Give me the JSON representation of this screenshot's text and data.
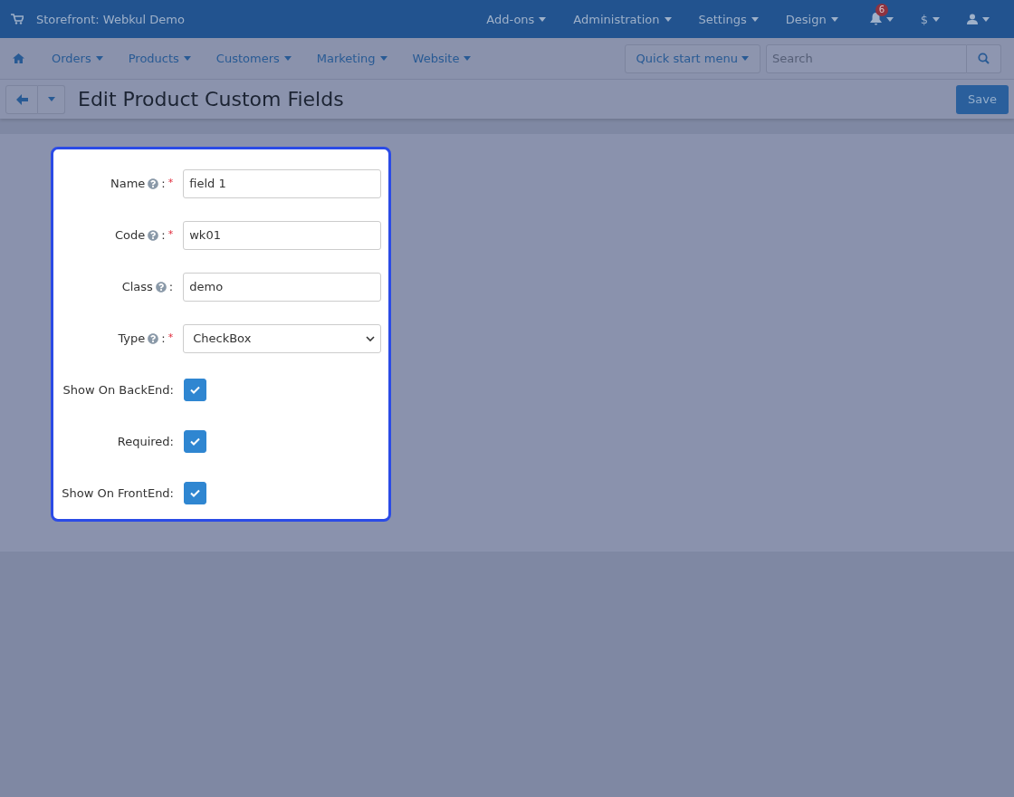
{
  "top_bar": {
    "store": "Storefront: Webkul Demo",
    "menus": [
      "Add-ons",
      "Administration",
      "Settings",
      "Design"
    ],
    "notifications": "6",
    "currency": "$"
  },
  "nav": {
    "items": [
      "Orders",
      "Products",
      "Customers",
      "Marketing",
      "Website"
    ],
    "quick_start": "Quick start menu",
    "search": {
      "placeholder": "Search"
    }
  },
  "title": "Edit Product Custom Fields",
  "save": "Save",
  "fields": [
    {
      "kind": "text",
      "label": "Name",
      "help": true,
      "colon": ":",
      "required_mark": "*",
      "value": "field 1"
    },
    {
      "kind": "text",
      "label": "Code",
      "help": true,
      "colon": ":",
      "required_mark": "*",
      "value": "wk01"
    },
    {
      "kind": "text",
      "label": "Class",
      "help": true,
      "colon": ":",
      "value": "demo"
    },
    {
      "kind": "select",
      "label": "Type",
      "help": true,
      "colon": ":",
      "required_mark": "*",
      "value": "CheckBox"
    },
    {
      "kind": "checkbox",
      "label": "Show On BackEnd:",
      "help": false,
      "checked": true
    },
    {
      "kind": "checkbox",
      "label": "Required:",
      "help": false,
      "checked": true
    },
    {
      "kind": "checkbox",
      "label": "Show On FrontEnd:",
      "help": false,
      "checked": true
    }
  ]
}
